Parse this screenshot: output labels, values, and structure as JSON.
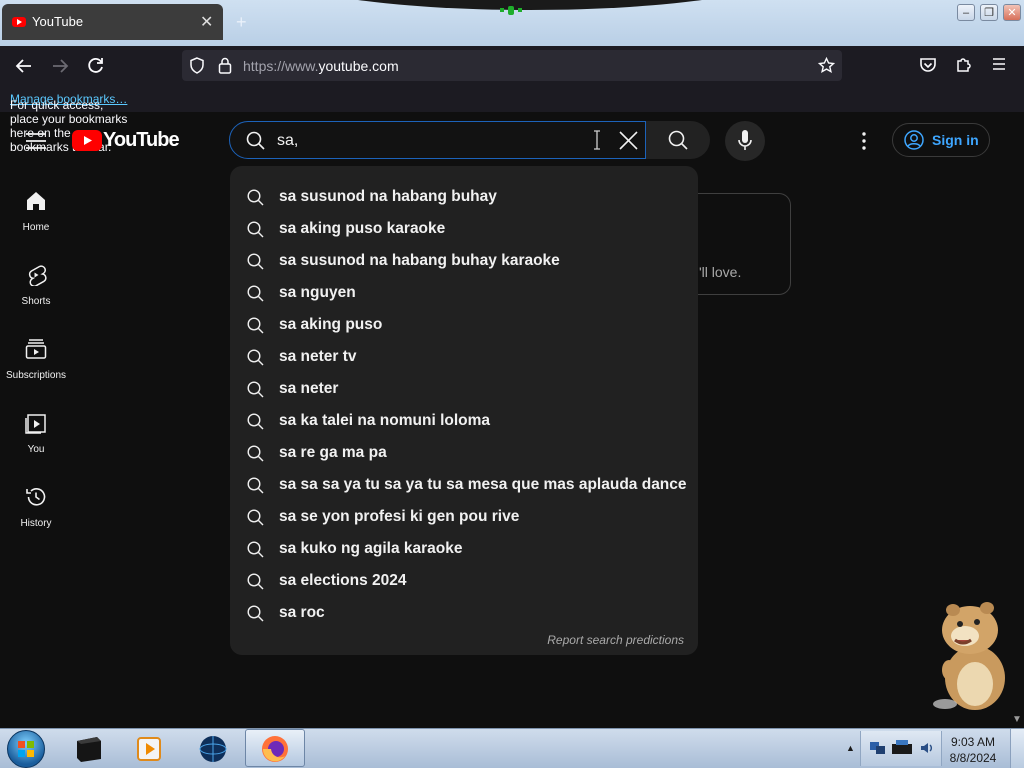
{
  "browser": {
    "tab_title": "YouTube",
    "tab_close": "✕",
    "new_tab": "+",
    "url_prefix": "https://www.",
    "url_domain": "youtube.com",
    "bookmarks_text": "For quick access, place your bookmarks here on the bookmarks toolbar.",
    "bookmarks_link": "Manage bookmarks…",
    "window_minimize": "–",
    "window_restore": "❐",
    "window_close": "✕"
  },
  "youtube": {
    "logo_text": "YouTube",
    "search_value": "sa,",
    "sign_in": "Sign in",
    "bg_card_text": "'ll love.",
    "sidebar": [
      {
        "label": "Home",
        "icon": "home-icon"
      },
      {
        "label": "Shorts",
        "icon": "shorts-icon"
      },
      {
        "label": "Subscriptions",
        "icon": "subscriptions-icon"
      },
      {
        "label": "You",
        "icon": "you-icon"
      },
      {
        "label": "History",
        "icon": "history-icon"
      }
    ],
    "suggestions": [
      "sa susunod na habang buhay",
      "sa aking puso karaoke",
      "sa susunod na habang buhay karaoke",
      "sa nguyen",
      "sa aking puso",
      "sa neter tv",
      "sa neter",
      "sa ka talei na nomuni loloma",
      "sa re ga ma pa",
      "sa sa sa ya tu sa ya tu sa mesa que mas aplauda dance",
      "sa se yon profesi ki gen pou rive",
      "sa kuko ng agila karaoke",
      "sa elections 2024",
      "sa roc"
    ],
    "report_text": "Report search predictions"
  },
  "taskbar": {
    "time": "9:03 AM",
    "date": "8/8/2024",
    "tray_arrow": "▲",
    "scroll_down": "▼"
  },
  "colors": {
    "yt_red": "#ff0000",
    "accent_blue": "#3ea6ff",
    "bg": "#0f0f0f",
    "dropdown_bg": "#212121"
  }
}
